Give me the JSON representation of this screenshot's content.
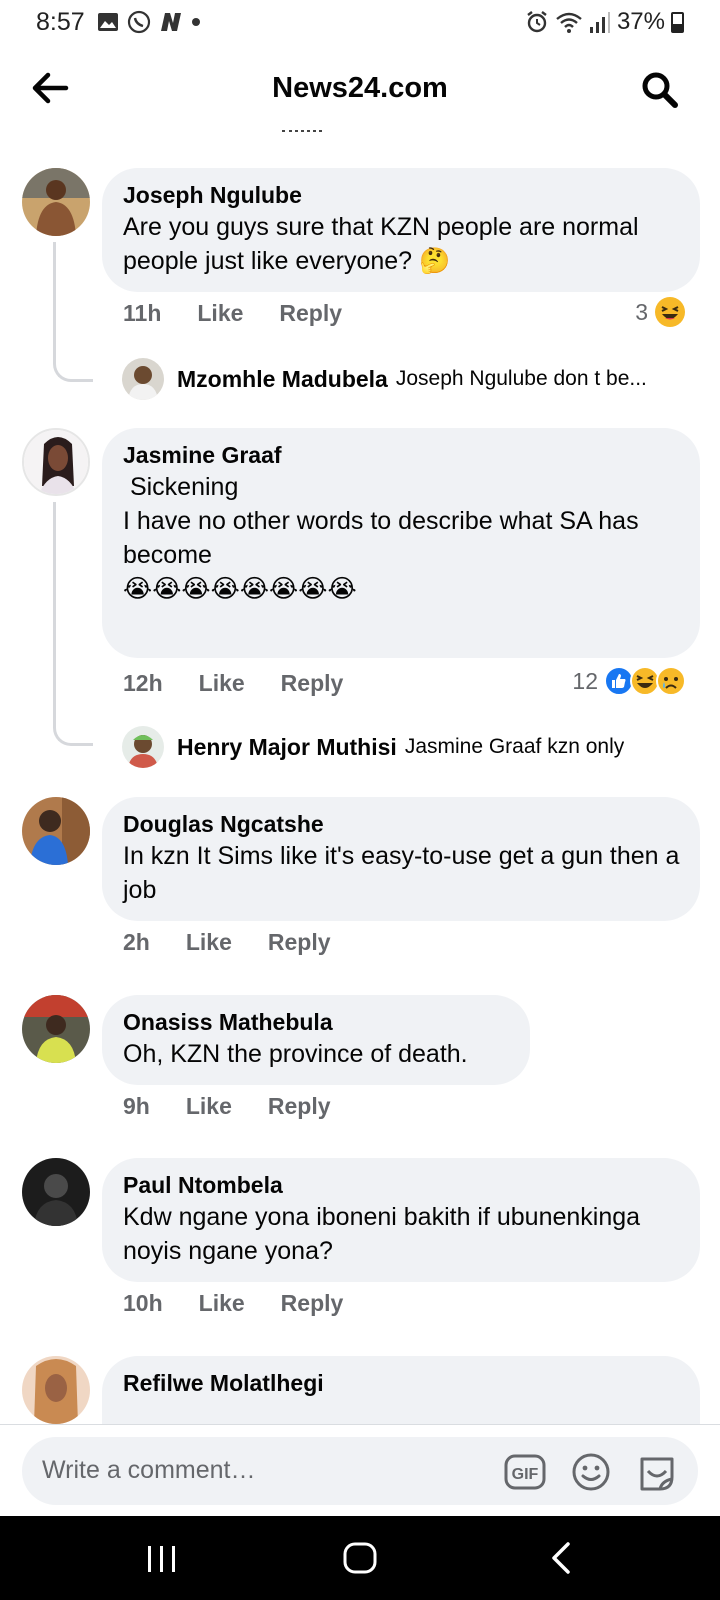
{
  "status_bar": {
    "time": "8:57",
    "battery": "37%"
  },
  "header": {
    "title": "News24.com"
  },
  "comments": [
    {
      "name": "Joseph Ngulube",
      "text": "Are you guys sure that KZN people are normal people just like everyone? 🤔",
      "time": "11h",
      "like": "Like",
      "reply": "Reply",
      "reaction_count": "3",
      "reply_preview": {
        "name": "Mzomhle Madubela",
        "text": "Joseph Ngulube don t be..."
      }
    },
    {
      "name": "Jasmine Graaf",
      "text": " Sickening\nI have no other words to describe what SA has become\n😭😭😭😭😭😭😭😭",
      "time": "12h",
      "like": "Like",
      "reply": "Reply",
      "reaction_count": "12",
      "reply_preview": {
        "name": "Henry Major Muthisi",
        "text": "Jasmine Graaf kzn only"
      }
    },
    {
      "name": "Douglas Ngcatshe",
      "text": "In kzn It Sims like it's easy-to-use get a gun then a job",
      "time": "2h",
      "like": "Like",
      "reply": "Reply"
    },
    {
      "name": "Onasiss Mathebula",
      "text": "Oh, KZN the province of death.",
      "time": "9h",
      "like": "Like",
      "reply": "Reply"
    },
    {
      "name": "Paul Ntombela",
      "text": "Kdw ngane yona iboneni bakith if ubunenkinga noyis ngane yona?",
      "time": "10h",
      "like": "Like",
      "reply": "Reply"
    },
    {
      "name": "Refilwe Molatlhegi"
    }
  ],
  "composer": {
    "placeholder": "Write a comment…",
    "gif_label": "GIF"
  },
  "colors": {
    "bubble": "#f0f2f5",
    "secondary_text": "#65676b",
    "like_blue": "#1877f2",
    "haha_yellow": "#f7b928"
  }
}
